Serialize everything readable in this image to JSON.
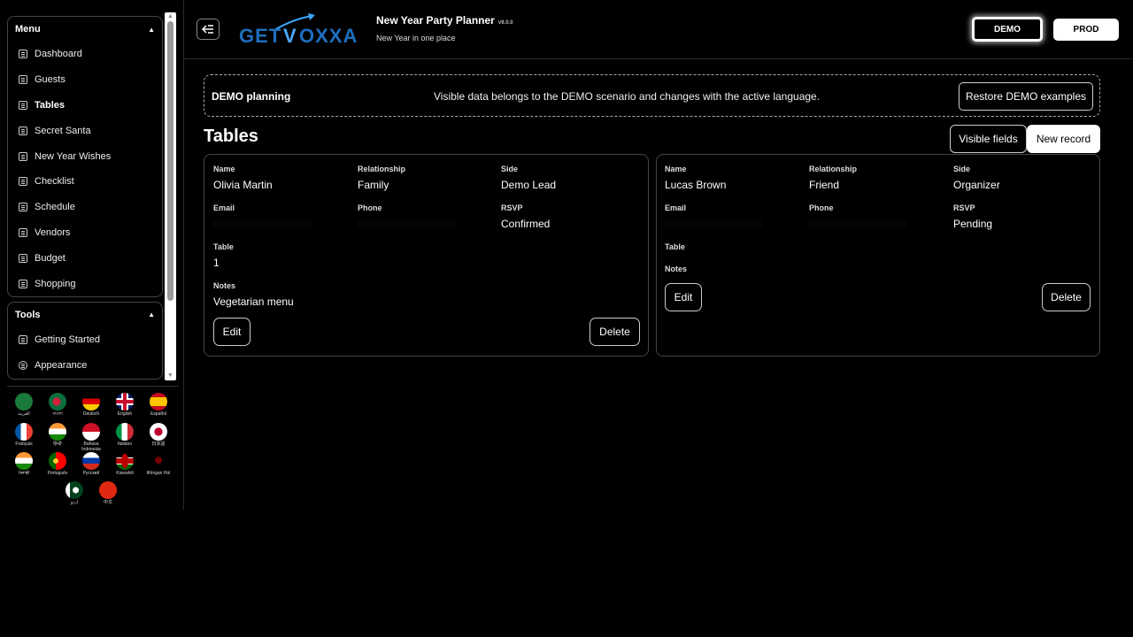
{
  "sidebar": {
    "menu_title": "Menu",
    "menu_items": [
      {
        "label": "Dashboard",
        "active": false
      },
      {
        "label": "Guests",
        "active": false
      },
      {
        "label": "Tables",
        "active": true
      },
      {
        "label": "Secret Santa",
        "active": false
      },
      {
        "label": "New Year Wishes",
        "active": false
      },
      {
        "label": "Checklist",
        "active": false
      },
      {
        "label": "Schedule",
        "active": false
      },
      {
        "label": "Vendors",
        "active": false
      },
      {
        "label": "Budget",
        "active": false
      },
      {
        "label": "Shopping",
        "active": false
      }
    ],
    "tools_title": "Tools",
    "tools_items": [
      {
        "label": "Getting Started"
      },
      {
        "label": "Appearance"
      }
    ],
    "languages": [
      {
        "label": "العربية"
      },
      {
        "label": "বাংলা"
      },
      {
        "label": "Deutsch"
      },
      {
        "label": "English"
      },
      {
        "label": "Español"
      },
      {
        "label": "Français"
      },
      {
        "label": "हिन्दी"
      },
      {
        "label": "Bahasa Indonesia"
      },
      {
        "label": "Italiano"
      },
      {
        "label": "日本語"
      },
      {
        "label": "ਪੰਜਾਬੀ"
      },
      {
        "label": "Português"
      },
      {
        "label": "Русский"
      },
      {
        "label": "Kiswahili"
      },
      {
        "label": "tlhIngan Hol"
      },
      {
        "label": "اردو"
      },
      {
        "label": "中文"
      }
    ]
  },
  "header": {
    "logo_text": "GETVOXXA",
    "title": "New Year Party Planner",
    "version": "v9.0.0",
    "subtitle": "New Year in one place",
    "demo_label": "DEMO",
    "prod_label": "PROD"
  },
  "banner": {
    "title": "DEMO planning",
    "text": "Visible data belongs to the DEMO scenario and changes with the active language.",
    "restore_label": "Restore DEMO examples"
  },
  "page": {
    "title": "Tables",
    "visible_fields_label": "Visible fields",
    "new_record_label": "New record"
  },
  "labels": {
    "name": "Name",
    "relationship": "Relationship",
    "side": "Side",
    "email": "Email",
    "phone": "Phone",
    "rsvp": "RSVP",
    "table": "Table",
    "notes": "Notes",
    "edit": "Edit",
    "delete": "Delete"
  },
  "records": [
    {
      "name": "Olivia Martin",
      "relationship": "Family",
      "side": "Demo Lead",
      "rsvp": "Confirmed",
      "table": "1",
      "notes": "Vegetarian menu"
    },
    {
      "name": "Lucas Brown",
      "relationship": "Friend",
      "side": "Organizer",
      "rsvp": "Pending",
      "table": "",
      "notes": ""
    }
  ],
  "colors": {
    "background": "#000000",
    "text": "#ffffff",
    "border": "#444444"
  }
}
